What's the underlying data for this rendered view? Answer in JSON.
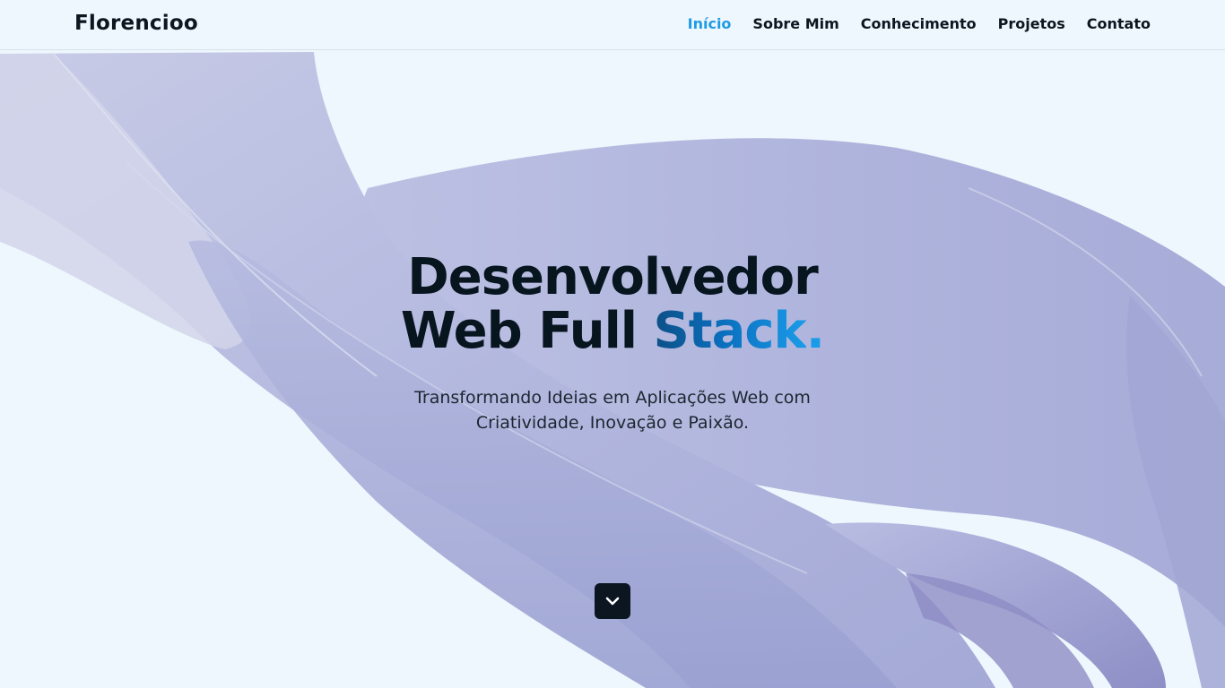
{
  "nav": {
    "brand": "Florencioo",
    "links": [
      {
        "label": "Início",
        "active": true
      },
      {
        "label": "Sobre Mim",
        "active": false
      },
      {
        "label": "Conhecimento",
        "active": false
      },
      {
        "label": "Projetos",
        "active": false
      },
      {
        "label": "Contato",
        "active": false
      }
    ]
  },
  "hero": {
    "title_line1": "Desenvolvedor",
    "title_line2_plain": "Web Full ",
    "title_line2_accent": "Stack",
    "title_line2_dot": ".",
    "subtitle": "Transformando Ideias em Aplicações Web com Criatividade, Inovação e Paixão."
  },
  "scroll_button": {
    "icon": "chevron-down-icon"
  },
  "colors": {
    "background": "#eef7fd",
    "text_dark": "#07151f",
    "accent": "#1f9be6",
    "ribbon": "#aab0d8"
  }
}
